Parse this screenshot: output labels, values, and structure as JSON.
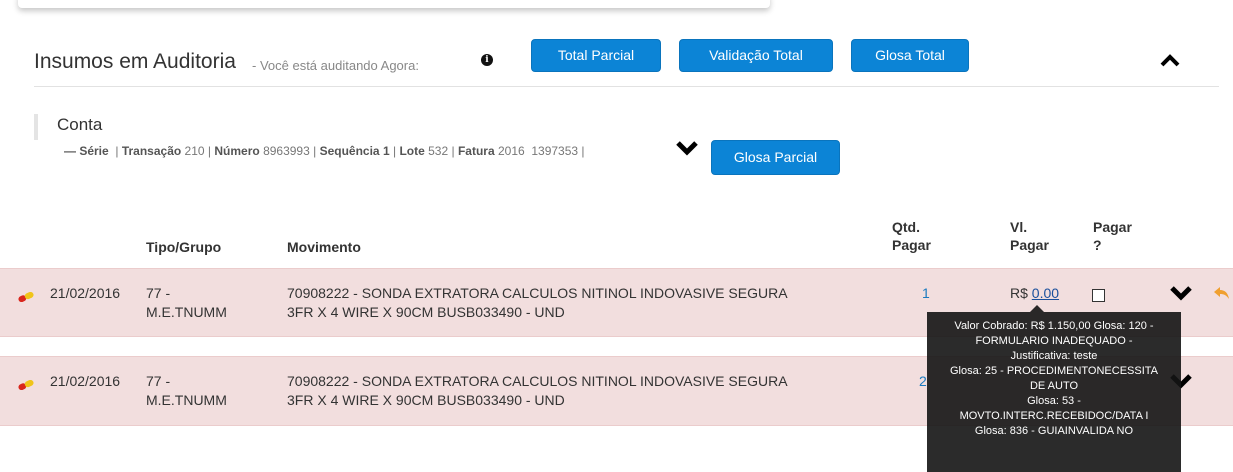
{
  "header": {
    "title": "Insumos em Auditoria",
    "subtitle": "- Você está auditando Agora:",
    "buttons": {
      "total_parcial": "Total Parcial",
      "validacao_total": "Validação Total",
      "glosa_total": "Glosa Total"
    }
  },
  "conta": {
    "title": "Conta",
    "meta": {
      "serie_prefix": "— Série",
      "transacao_label": "Transação",
      "transacao_value": "210",
      "numero_label": "Número",
      "numero_value": "8963993",
      "sequencia_label": "Sequência",
      "sequencia_value": "1",
      "lote_label": "Lote",
      "lote_value": "532",
      "fatura_label": "Fatura",
      "fatura_value": "2016",
      "extra_value": "1397353"
    },
    "glosa_parcial_label": "Glosa Parcial"
  },
  "table": {
    "headers": {
      "tipo_grupo": "Tipo/Grupo",
      "movimento": "Movimento",
      "qtd_pagar_line1": "Qtd.",
      "qtd_pagar_line2": "Pagar",
      "vl_pagar_line1": "Vl.",
      "vl_pagar_line2": "Pagar",
      "pagar_line1": "Pagar",
      "pagar_line2": "?"
    },
    "rows": [
      {
        "date": "21/02/2016",
        "tipo_line1": "77 -",
        "tipo_line2": "M.E.TNUMM",
        "mov_line1": "70908222 - SONDA EXTRATORA CALCULOS NITINOL INDOVASIVE SEGURA",
        "mov_line2": "3FR X 4 WIRE X 90CM BUSB033490 - UND",
        "qtd": "1",
        "vl_prefix": "R$",
        "vl_value": "0.00"
      },
      {
        "date": "21/02/2016",
        "tipo_line1": "77 -",
        "tipo_line2": "M.E.TNUMM",
        "mov_line1": "70908222 - SONDA EXTRATORA CALCULOS NITINOL INDOVASIVE SEGURA",
        "mov_line2": "3FR X 4 WIRE X 90CM BUSB033490 - UND",
        "qtd": "2"
      }
    ]
  },
  "tooltip": {
    "lines": [
      "Valor Cobrado: R$ 1.150,00 Glosa: 120 -",
      "FORMULARIO INADEQUADO -",
      "Justificativa: teste",
      "Glosa: 25 - PROCEDIMENTONECESSITA",
      "DE AUTO",
      "Glosa: 53 -",
      "MOVTO.INTERC.RECEBIDOC/DATA I",
      "Glosa: 836 - GUIAINVALIDA NO"
    ]
  },
  "colors": {
    "button": "#0c84d6",
    "row_bg": "#f2dede",
    "link": "#1a7abf",
    "tooltip_bg": "#141414"
  },
  "icons": {
    "info": "info-circle-icon",
    "collapse": "chevron-up-icon",
    "expand": "chevron-down-icon",
    "item": "pill-icon",
    "undo": "undo-icon"
  }
}
